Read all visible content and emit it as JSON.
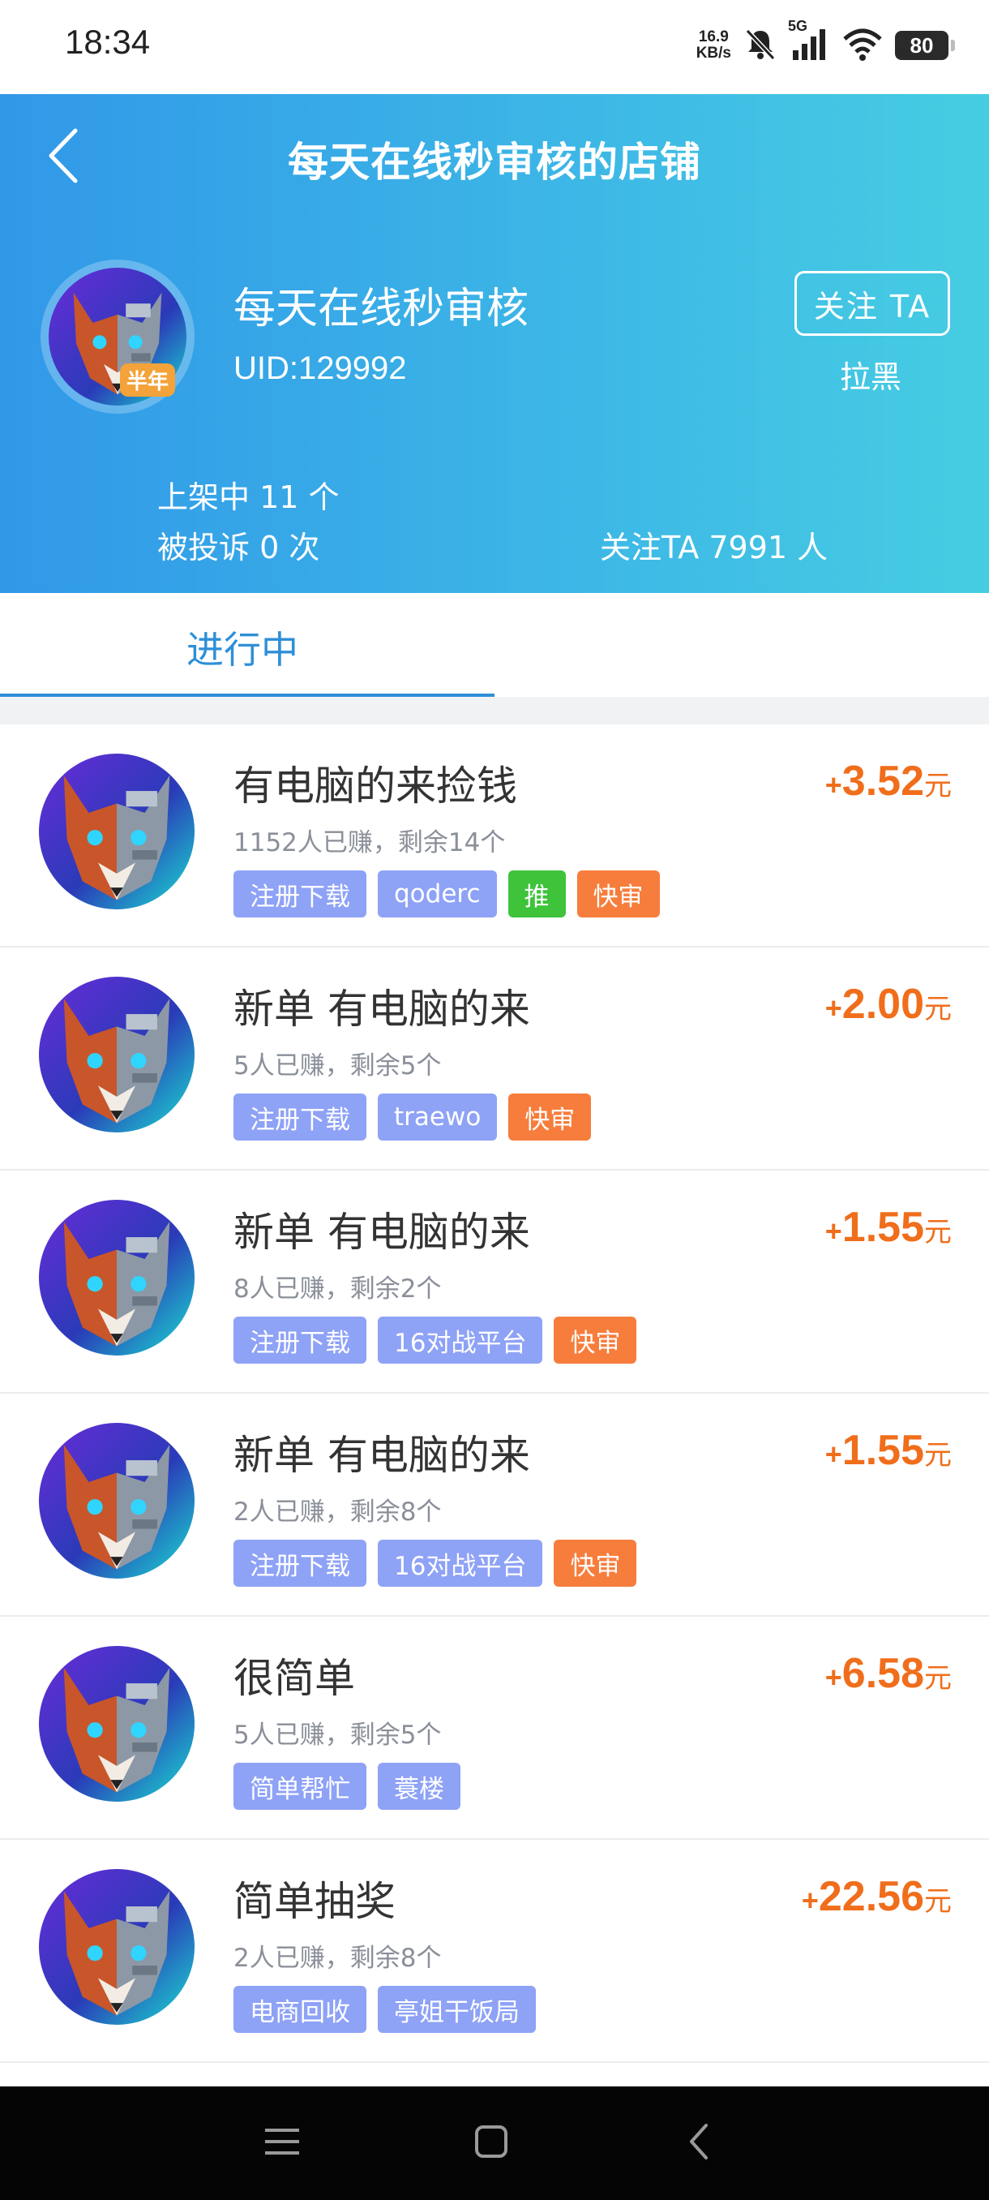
{
  "status_bar": {
    "time": "18:34",
    "net_speed_value": "16.9",
    "net_speed_unit": "KB/s",
    "network_type": "5G",
    "battery": "80"
  },
  "header": {
    "title": "每天在线秒审核的店铺",
    "shop_name": "每天在线秒审核",
    "uid": "UID:129992",
    "avatar_badge": "半年",
    "follow_label": "关注 TA",
    "block_label": "拉黑",
    "listed": "上架中 11 个",
    "complaints": "被投诉 0 次",
    "followers": "关注TA 7991 人"
  },
  "tabs": [
    {
      "label": "进行中",
      "active": true
    }
  ],
  "tasks": [
    {
      "title": "有电脑的来捡钱",
      "stats": "1152人已赚，剩余14个",
      "price": "3.52",
      "unit": "元",
      "tags": [
        {
          "text": "注册下载",
          "color": "blue"
        },
        {
          "text": "qoderc",
          "color": "blue"
        },
        {
          "text": "推",
          "color": "green"
        },
        {
          "text": "快审",
          "color": "orange"
        }
      ]
    },
    {
      "title": "新单 有电脑的来",
      "stats": "5人已赚，剩余5个",
      "price": "2.00",
      "unit": "元",
      "tags": [
        {
          "text": "注册下载",
          "color": "blue"
        },
        {
          "text": "traewo",
          "color": "blue"
        },
        {
          "text": "快审",
          "color": "orange"
        }
      ]
    },
    {
      "title": "新单 有电脑的来",
      "stats": "8人已赚，剩余2个",
      "price": "1.55",
      "unit": "元",
      "tags": [
        {
          "text": "注册下载",
          "color": "blue"
        },
        {
          "text": "16对战平台",
          "color": "blue"
        },
        {
          "text": "快审",
          "color": "orange"
        }
      ]
    },
    {
      "title": "新单 有电脑的来",
      "stats": "2人已赚，剩余8个",
      "price": "1.55",
      "unit": "元",
      "tags": [
        {
          "text": "注册下载",
          "color": "blue"
        },
        {
          "text": "16对战平台",
          "color": "blue"
        },
        {
          "text": "快审",
          "color": "orange"
        }
      ]
    },
    {
      "title": "很简单",
      "stats": "5人已赚，剩余5个",
      "price": "6.58",
      "unit": "元",
      "tags": [
        {
          "text": "简单帮忙",
          "color": "blue"
        },
        {
          "text": "蓑楼",
          "color": "blue"
        }
      ]
    },
    {
      "title": "简单抽奖",
      "stats": "2人已赚，剩余8个",
      "price": "22.56",
      "unit": "元",
      "tags": [
        {
          "text": "电商回收",
          "color": "blue"
        },
        {
          "text": "亭姐干饭局",
          "color": "blue"
        }
      ]
    }
  ],
  "colors": {
    "header_start": "#3198e8",
    "header_end": "#46cde2",
    "accent_blue": "#2e8fd8",
    "price_orange": "#f06e1b",
    "tag_blue": "#8ea2f6",
    "tag_green": "#3ec33b",
    "tag_orange": "#f77d3c"
  },
  "icons": [
    "back-arrow-icon",
    "mute-bell-icon",
    "signal-icon",
    "wifi-icon",
    "battery-icon",
    "nav-menu-icon",
    "nav-home-icon",
    "nav-back-icon"
  ]
}
